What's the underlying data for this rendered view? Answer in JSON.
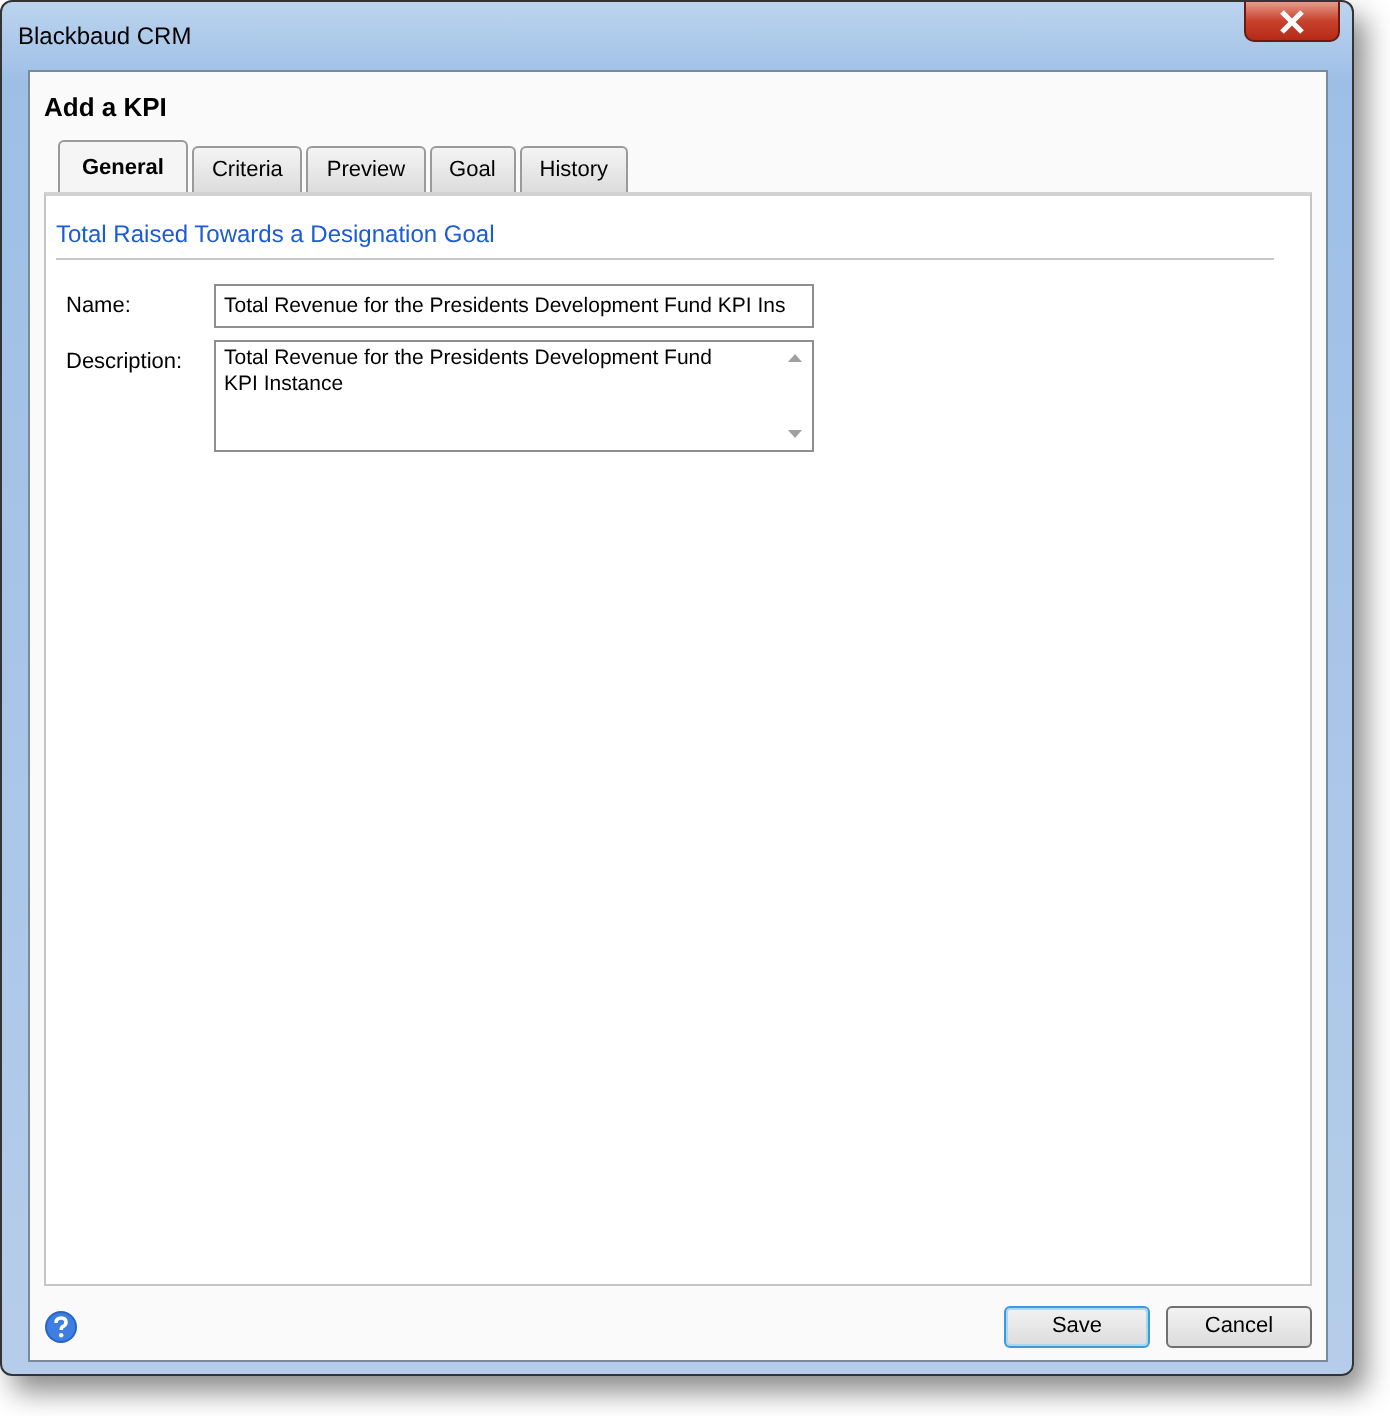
{
  "window": {
    "title": "Blackbaud CRM"
  },
  "dialog": {
    "title": "Add a KPI"
  },
  "tabs": [
    {
      "label": "General",
      "selected": true
    },
    {
      "label": "Criteria",
      "selected": false
    },
    {
      "label": "Preview",
      "selected": false
    },
    {
      "label": "Goal",
      "selected": false
    },
    {
      "label": "History",
      "selected": false
    }
  ],
  "section_heading": "Total Raised Towards a Designation Goal",
  "fields": [
    {
      "kind": "text",
      "label": "Name:",
      "value": "Total Revenue for the Presidents Development Fund KPI Ins"
    },
    {
      "kind": "textarea",
      "label": "Description:",
      "value": "Total Revenue for the Presidents Development Fund\nKPI Instance"
    }
  ],
  "buttons": [
    {
      "label": "Save",
      "default": true
    },
    {
      "label": "Cancel",
      "default": false
    }
  ]
}
